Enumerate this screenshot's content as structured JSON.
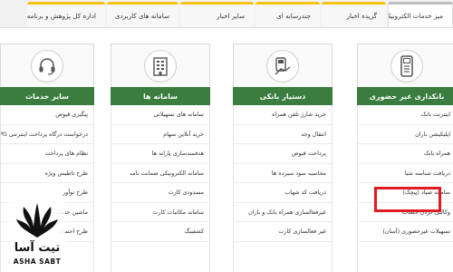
{
  "tabs": [
    "میز خدمات الکترونیک",
    "گزیده اخبار",
    "چندرسانه ای",
    "سایر اخبار",
    "سامانه های کاربردی",
    "اداره کل پژوهش و برنامه ریزی"
  ],
  "panels": [
    {
      "title": "بانکداری غیر حضوری",
      "icon": "pos-terminal-icon",
      "items": [
        "اینترنت بانک",
        "اپلیکیشن باران",
        "همراه بانک",
        "دریافت شناسه شبا",
        "سامانه صیاد (پیچک)",
        "وکالتی کردن حساب",
        "تسهیلات غیرحضوری (آسان)"
      ]
    },
    {
      "title": "دستیار بانکی",
      "icon": "card-in-hand-icon",
      "items": [
        "خرید شارژ تلفن همراه",
        "انتقال وجه",
        "پرداخت قبوض",
        "محاسبه سود سپرده ها",
        "دریافت کد شهاب",
        "غیرفعالسازی همراه بانک و باران",
        "غیر فعالسازی کارت"
      ]
    },
    {
      "title": "سامانه ها",
      "icon": "building-icon",
      "items": [
        "سامانه های تسهیلاتی",
        "خرید آنلاین سهام",
        "هدفمندسازی یارانه ها",
        "سامانه الکترونیکی ضمانت نامه",
        "مسدودی کارت",
        "سامانه مکاتبات کارت",
        "کشفینگ"
      ]
    },
    {
      "title": "سایر خدمات",
      "icon": "headset-icon",
      "items": [
        "پیگیری قبوض",
        "درخواست درگاه پرداخت اینترنتی IPG",
        "نظام های پرداخت",
        "طرح تاطیس ویژه",
        "طرح نوآور",
        "ماشین حساب",
        "طرح احسان"
      ]
    }
  ],
  "logo": {
    "fa": "تیت آسا",
    "en": "ASHA SABT"
  }
}
